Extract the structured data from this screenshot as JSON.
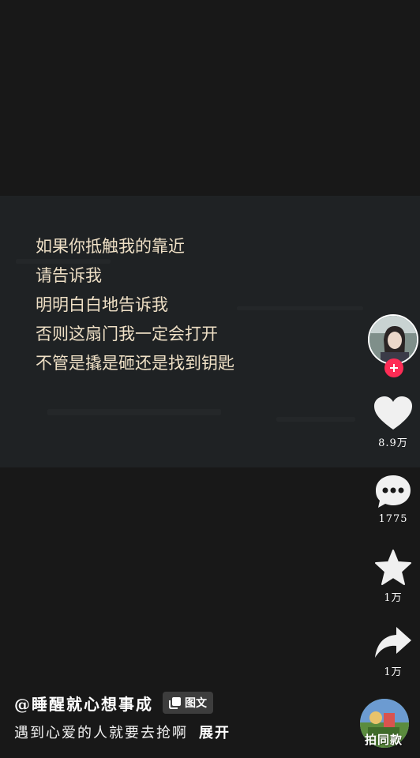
{
  "post": {
    "lyrics": [
      "如果你抵触我的靠近",
      "请告诉我",
      "明明白白地告诉我",
      "否则这扇门我一定会打开",
      "不管是撬是砸还是找到钥匙"
    ]
  },
  "rail": {
    "like_count": "8.9万",
    "comment_count": "1775",
    "favorite_count": "1万",
    "share_count": "1万"
  },
  "author": {
    "handle": "@睡醒就心想事成",
    "type_tag": "图文"
  },
  "caption": {
    "text": "遇到心爱的人就要去抢啊",
    "expand_label": "展开"
  },
  "music": {
    "label": "拍同款"
  },
  "colors": {
    "background": "#181818",
    "lyric_text": "#efe0c6",
    "follow_accent": "#fe2c55"
  },
  "icons": [
    "plus-icon",
    "heart-icon",
    "comment-icon",
    "star-icon",
    "share-icon",
    "gallery-icon"
  ]
}
